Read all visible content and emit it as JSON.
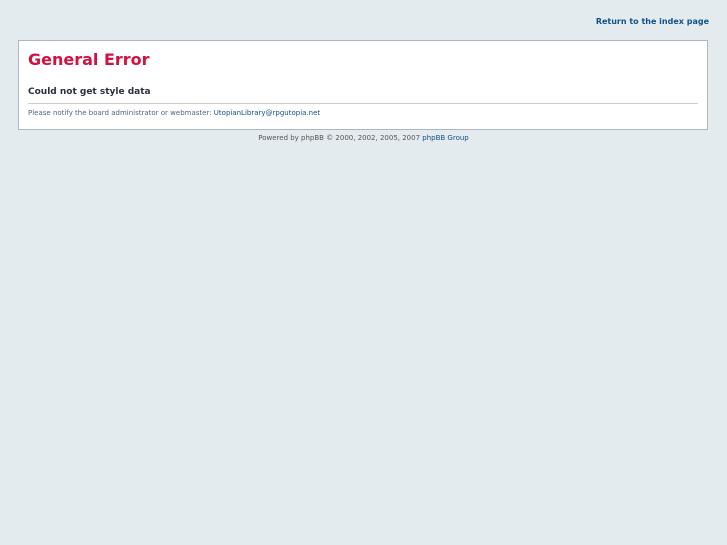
{
  "header": {
    "index_link": "Return to the index page"
  },
  "error": {
    "title": "General Error",
    "message": "Could not get style data",
    "notice_text": "Please notify the board administrator or webmaster: ",
    "webmaster_email": "UtopianLibrary@rpgutopia.net"
  },
  "footer": {
    "text": "Powered by phpBB © 2000, 2002, 2005, 2007 ",
    "link": "phpBB Group"
  }
}
